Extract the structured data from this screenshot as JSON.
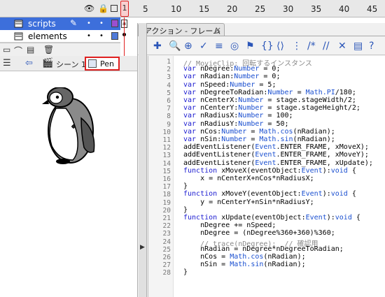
{
  "timeline": {
    "header_icons": [
      "eye-icon",
      "lock-icon",
      "outline-icon"
    ],
    "playhead_frame": "1",
    "ruler_numbers": [
      "5",
      "10",
      "15",
      "20",
      "25",
      "30",
      "35",
      "40",
      "45"
    ],
    "layers": [
      {
        "name": "scripts",
        "selected": true,
        "color": "#9b4fd0"
      },
      {
        "name": "elements",
        "selected": false,
        "color": "#4f7ad8"
      }
    ]
  },
  "actions_panel": {
    "tab_title": "アクション - フレーム",
    "tab_close": "×",
    "toolbar_icons": [
      "add-icon",
      "find-icon",
      "target-icon",
      "check-syntax-icon",
      "auto-format-icon",
      "code-hint-icon",
      "debug-icon",
      "collapse-between-braces-icon",
      "collapse-selection-icon",
      "expand-all-icon",
      "comment-block-icon",
      "comment-line-icon",
      "uncomment-icon",
      "show-hide-toolbox-icon",
      "help-icon"
    ],
    "line_numbers": [
      "1",
      "2",
      "3",
      "4",
      "5",
      "6",
      "7",
      "8",
      "9",
      "10",
      "11",
      "12",
      "13",
      "14",
      "15",
      "16",
      "17",
      "18",
      "19",
      "20",
      "21",
      "22",
      "23",
      "24",
      "25",
      "26",
      "27",
      "28"
    ],
    "code_lines": [
      "// MovieClip: 回転するインスタンス",
      "var nDegree:Number = 0;",
      "var nRadian:Number = 0;",
      "var nSpeed:Number = 5;",
      "var nDegreeToRadian:Number = Math.PI/180;",
      "var nCenterX:Number = stage.stageWidth/2;",
      "var nCenterY:Number = stage.stageHeight/2;",
      "var nRadiusX:Number = 100;",
      "var nRadiusY:Number = 50;",
      "var nCos:Number = Math.cos(nRadian);",
      "var nSin:Number = Math.sin(nRadian);",
      "addEventListener(Event.ENTER_FRAME, xMoveX);",
      "addEventListener(Event.ENTER_FRAME, xMoveY);",
      "addEventListener(Event.ENTER_FRAME, xUpdate);",
      "function xMoveX(eventObject:Event):void {",
      "    x = nCenterX+nCos*nRadiusX;",
      "}",
      "function xMoveY(eventObject:Event):void {",
      "    y = nCenterY+nSin*nRadiusY;",
      "}",
      "function xUpdate(eventObject:Event):void {",
      "    nDegree += nSpeed;",
      "    nDegree = (nDegree%360+360)%360;",
      "    // trace(nDegree);  // 確認用",
      "    nRadian = nDegree*nDegreeToRadian;",
      "    nCos = Math.cos(nRadian);",
      "    nSin = Math.sin(nRadian);",
      "}"
    ]
  },
  "stage_bar": {
    "back_icon": "back-arrow-icon",
    "scene_label": "シーン 1",
    "symbol_button_label": "Pen"
  },
  "stage": {
    "content_icon": "penguin-illustration"
  },
  "colors": {
    "selected_layer": "#3d6fdb",
    "highlight_red": "#e02020",
    "keyword_blue": "#1a1ad0",
    "comment_gray": "#8a8a8a"
  }
}
